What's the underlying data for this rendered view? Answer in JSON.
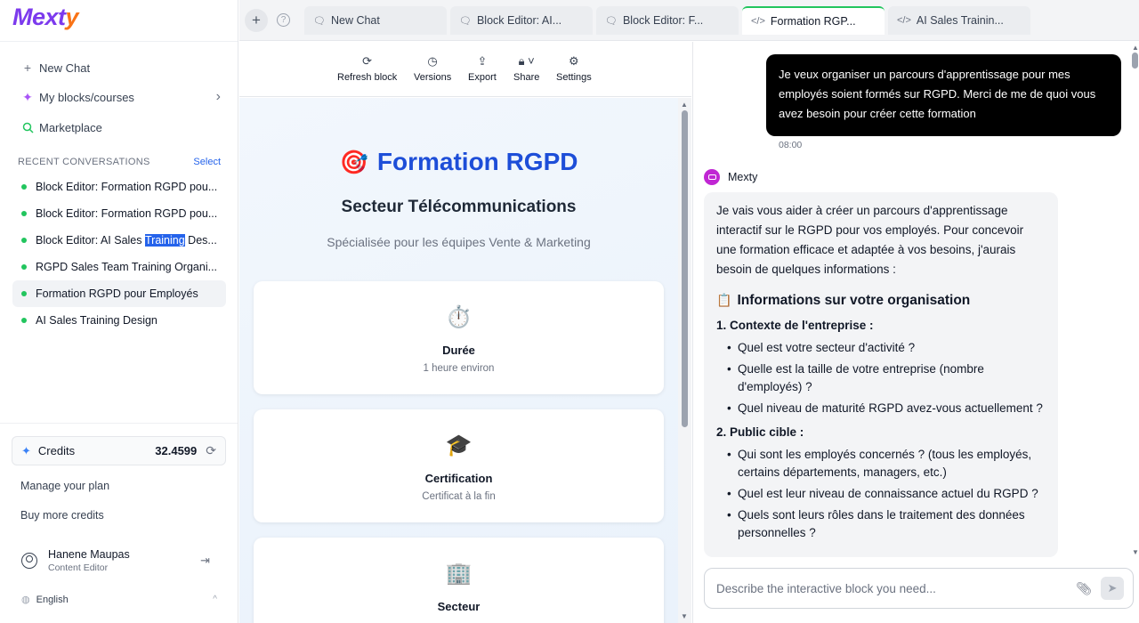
{
  "sidebar": {
    "logo_main": "Mext",
    "logo_accent": "y",
    "nav": [
      {
        "label": "New Chat",
        "icon": "plus-icon"
      },
      {
        "label": "My blocks/courses",
        "icon": "sparkle-icon"
      },
      {
        "label": "Marketplace",
        "icon": "search-icon"
      }
    ],
    "recent_heading": "RECENT CONVERSATIONS",
    "select_label": "Select",
    "conversations": [
      {
        "pre": "Block Editor: Formation RGPD pou...",
        "hl": "",
        "post": ""
      },
      {
        "pre": "Block Editor: Formation RGPD pou...",
        "hl": "",
        "post": ""
      },
      {
        "pre": "Block Editor: AI Sales ",
        "hl": "Training",
        "post": " Des..."
      },
      {
        "pre": "RGPD Sales Team Training Organi...",
        "hl": "",
        "post": ""
      },
      {
        "pre": "Formation RGPD pour Employés",
        "hl": "",
        "post": ""
      },
      {
        "pre": "AI Sales Training Design",
        "hl": "",
        "post": ""
      }
    ],
    "credits_label": "Credits",
    "credits_value": "32.4599",
    "manage_plan": "Manage your plan",
    "buy_credits": "Buy more credits",
    "user_name": "Hanene Maupas",
    "user_role": "Content Editor",
    "language": "English",
    "status_color": "#22c55e",
    "brand_color": "#7c3aed"
  },
  "tabs": [
    {
      "label": "New Chat",
      "icon": "chat-icon"
    },
    {
      "label": "Block Editor: AI...",
      "icon": "chat-icon"
    },
    {
      "label": "Block Editor: F...",
      "icon": "chat-icon"
    },
    {
      "label": "Formation RGP...",
      "icon": "code-icon",
      "active": true
    },
    {
      "label": "AI Sales Trainin...",
      "icon": "code-icon"
    }
  ],
  "toolbar": {
    "refresh": "Refresh block",
    "versions": "Versions",
    "export": "Export",
    "share": "Share",
    "settings": "Settings"
  },
  "preview": {
    "title": "Formation RGPD",
    "subtitle": "Secteur Télécommunications",
    "tagline": "Spécialisée pour les équipes Vente & Marketing",
    "cards": [
      {
        "title": "Durée",
        "subtitle": "1 heure environ",
        "icon": "stopwatch-icon"
      },
      {
        "title": "Certification",
        "subtitle": "Certificat à la fin",
        "icon": "graduation-cap-icon"
      },
      {
        "title": "Secteur",
        "subtitle": "",
        "icon": "building-icon"
      }
    ]
  },
  "chat": {
    "user_message": "Je veux organiser un parcours d'apprentissage pour mes employés soient formés sur RGPD. Merci de me de quoi vous avez besoin pour créer cette formation",
    "user_time": "08:00",
    "bot_name": "Mexty",
    "bot_intro": "Je vais vous aider à créer un parcours d'apprentissage interactif sur le RGPD pour vos employés. Pour concevoir une formation efficace et adaptée à vos besoins, j'aurais besoin de quelques informations :",
    "section_title": "Informations sur votre organisation",
    "part1_title": "1. Contexte de l'entreprise :",
    "part1_items": [
      "Quel est votre secteur d'activité ?",
      "Quelle est la taille de votre entreprise (nombre d'employés) ?",
      "Quel niveau de maturité RGPD avez-vous actuellement ?"
    ],
    "part2_title": "2. Public cible :",
    "part2_items": [
      "Qui sont les employés concernés ? (tous les employés, certains départements, managers, etc.)",
      "Quel est leur niveau de connaissance actuel du RGPD ?",
      "Quels sont leurs rôles dans le traitement des données personnelles ?"
    ],
    "input_placeholder": "Describe the interactive block you need..."
  }
}
